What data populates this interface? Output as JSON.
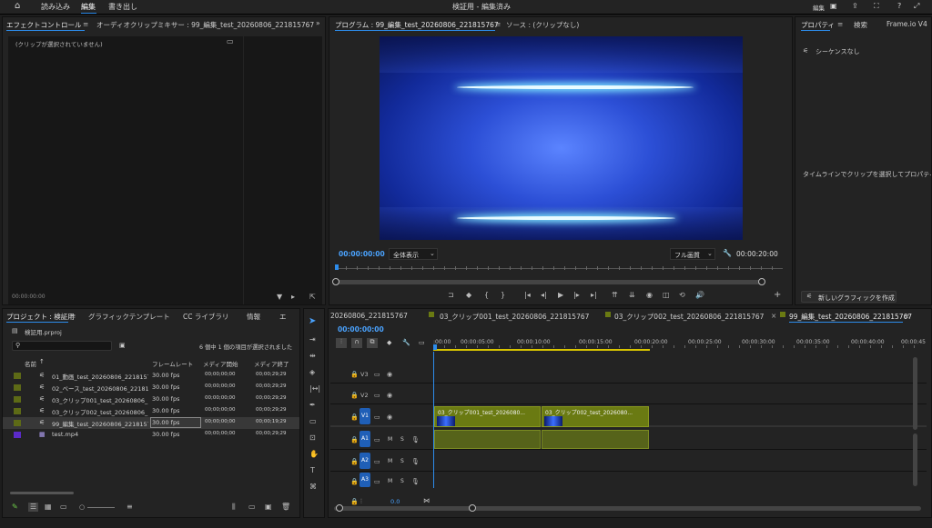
{
  "app": {
    "window_title": "検証用 - 編集済み",
    "menu": [
      "読み込み",
      "編集",
      "書き出し"
    ],
    "right_label": "編集"
  },
  "effect_panel": {
    "tabs": [
      "エフェクトコントロール",
      "オーディオクリップミキサー : 99_編集_test_20260806_221815767"
    ],
    "message": "(クリップが選択されていません)",
    "timecode": "00:00:00:00"
  },
  "program_monitor": {
    "tabs": [
      "プログラム : 99_編集_test_20260806_221815767",
      "ソース : (クリップなし)"
    ],
    "timecode_current": "00:00:00:00",
    "zoom": "全体表示",
    "quality": "フル画質",
    "timecode_duration": "00:00:20:00"
  },
  "properties_panel": {
    "tabs": [
      "プロパティ",
      "検索",
      "Frame.io V4"
    ],
    "sequence_label": "シーケンスなし",
    "hint": "タイムラインでクリップを選択してプロパティ",
    "button": "新しいグラフィックを作成"
  },
  "project_panel": {
    "tabs": [
      "プロジェクト : 検証用",
      "グラフィックテンプレート",
      "CC ライブラリ",
      "情報",
      "エ"
    ],
    "file": "検証用.prproj",
    "status": "6 個中 1 個の項目が選択されました",
    "columns": [
      "名前",
      "フレームレート",
      "メディア開始",
      "メディア終了"
    ],
    "items": [
      {
        "name": "01_動画_test_20260806_2218157",
        "fps": "30.00 fps",
        "start": "00;00;00;00",
        "end": "00;00;29;29",
        "color": "#5d6a16",
        "selected": false
      },
      {
        "name": "02_ベース_test_20260806_22181",
        "fps": "30.00 fps",
        "start": "00;00;00;00",
        "end": "00;00;29;29",
        "color": "#5d6a16",
        "selected": false
      },
      {
        "name": "03_クリップ001_test_20260806_",
        "fps": "30.00 fps",
        "start": "00;00;00;00",
        "end": "00;00;29;29",
        "color": "#5d6a16",
        "selected": false
      },
      {
        "name": "03_クリップ002_test_20260806_",
        "fps": "30.00 fps",
        "start": "00;00;00;00",
        "end": "00;00;29;29",
        "color": "#5d6a16",
        "selected": false
      },
      {
        "name": "99_編集_test_20260806_2218157",
        "fps": "30.00 fps",
        "start": "00;00;00;00",
        "end": "00;00;19;29",
        "color": "#5d6a16",
        "selected": true
      },
      {
        "name": "test.mp4",
        "fps": "30.00 fps",
        "start": "00;00;00;00",
        "end": "00;00;29;29",
        "color": "#5b2ac9",
        "selected": false
      }
    ]
  },
  "timeline": {
    "tabs": [
      "20260806_221815767",
      "03_クリップ001_test_20260806_221815767",
      "03_クリップ002_test_20260806_221815767",
      "99_編集_test_20260806_221815767"
    ],
    "timecode": "00:00:00:00",
    "ruler": [
      ":00:00",
      "00:00:05:00",
      "00:00:10:00",
      "00:00:15:00",
      "00:00:20:00",
      "00:00:25:00",
      "00:00:30:00",
      "00:00:35:00",
      "00:00:40:00",
      "00:00:45"
    ],
    "video_tracks": [
      "V3",
      "V2",
      "V1"
    ],
    "audio_tracks": [
      "A1",
      "A2",
      "A3"
    ],
    "clip1": "03_クリップ001_test_2026080...",
    "clip2": "03_クリップ002_test_2026080...",
    "mix_value": "0.0",
    "ms_m": "M",
    "ms_s": "S"
  }
}
